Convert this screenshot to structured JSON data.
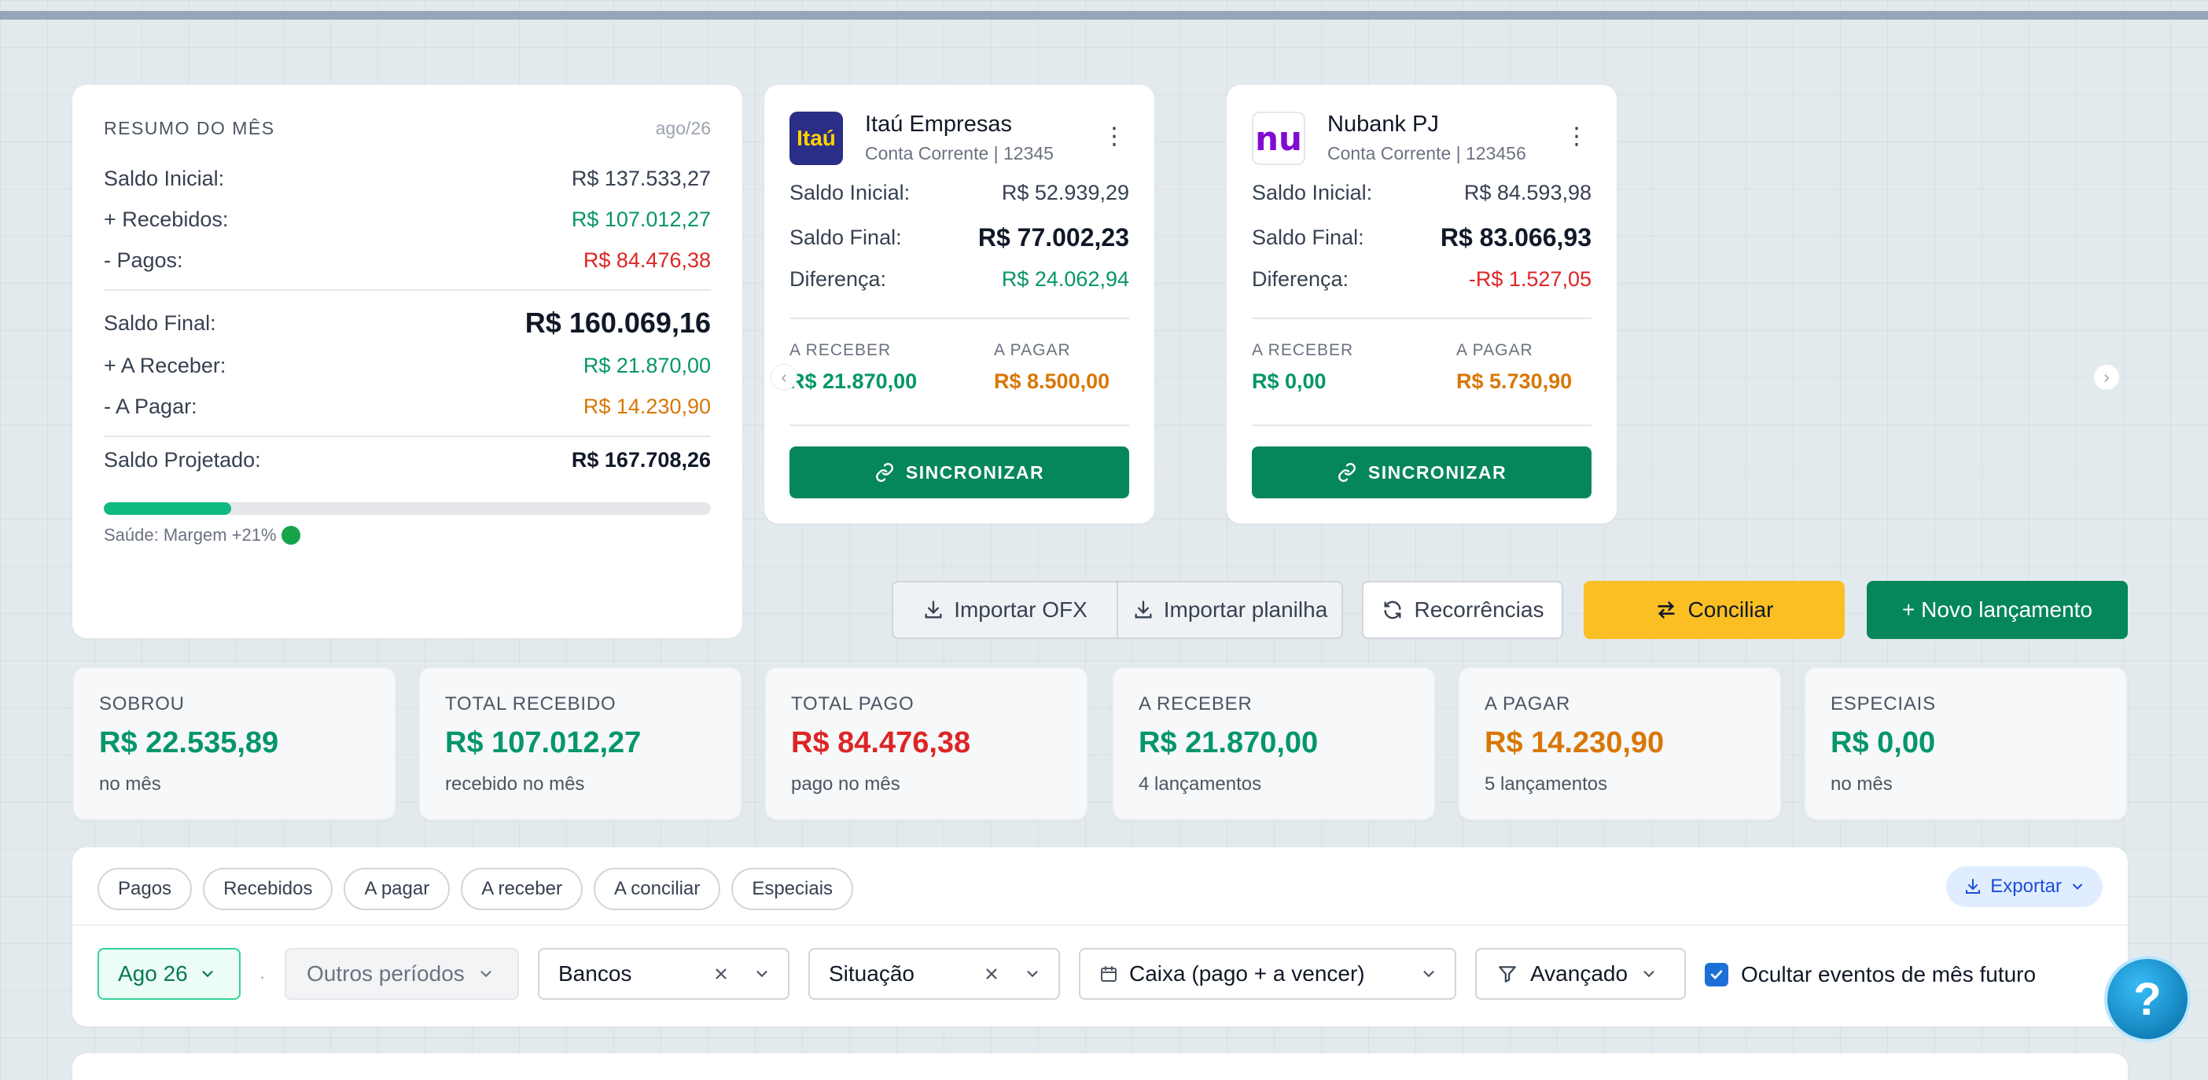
{
  "summary": {
    "title": "RESUMO DO MÊS",
    "period": "ago/26",
    "rows": [
      {
        "label": "Saldo Inicial:",
        "value": "R$ 137.533,27"
      },
      {
        "label": "+ Recebidos:",
        "value": "R$ 107.012,27"
      },
      {
        "label": "- Pagos:",
        "value": "R$ 84.476,38"
      },
      {
        "label": "Saldo Final:",
        "value": "R$ 160.069,16"
      },
      {
        "label": "+ A Receber:",
        "value": "R$ 21.870,00"
      },
      {
        "label": "- A Pagar:",
        "value": "R$ 14.230,90"
      },
      {
        "label": "Saldo Projetado:",
        "value": "R$ 167.708,26"
      }
    ],
    "health_fraction": 0.21,
    "health_text": "Saúde: Margem +21%"
  },
  "banks": [
    {
      "logo_text": "Itaú",
      "name": "Itaú Empresas",
      "account": "Conta Corrente | 12345",
      "initial_label": "Saldo Inicial:",
      "initial": "R$ 52.939,29",
      "final_label": "Saldo Final:",
      "final": "R$ 77.002,23",
      "diff_label": "Diferença:",
      "diff": "R$ 24.062,94",
      "receive_label": "A RECEBER",
      "receive": "R$ 21.870,00",
      "pay_label": "A PAGAR",
      "pay": "R$ 8.500,00",
      "sync": "SINCRONIZAR"
    },
    {
      "logo_text": "nu",
      "name": "Nubank PJ",
      "account": "Conta Corrente | 123456",
      "initial_label": "Saldo Inicial:",
      "initial": "R$ 84.593,98",
      "final_label": "Saldo Final:",
      "final": "R$ 83.066,93",
      "diff_label": "Diferença:",
      "diff": "-R$ 1.527,05",
      "receive_label": "A RECEBER",
      "receive": "R$ 0,00",
      "pay_label": "A PAGAR",
      "pay": "R$ 5.730,90",
      "sync": "SINCRONIZAR"
    }
  ],
  "actions": {
    "import_ofx": "Importar OFX",
    "import_sheet": "Importar planilha",
    "recurrences": "Recorrências",
    "reconcile": "Conciliar",
    "new_entry": "+ Novo lançamento"
  },
  "stats": [
    {
      "label": "SOBROU",
      "value": "R$ 22.535,89",
      "sub": "no mês",
      "color": "#059669"
    },
    {
      "label": "TOTAL RECEBIDO",
      "value": "R$ 107.012,27",
      "sub": "recebido no mês",
      "color": "#059669"
    },
    {
      "label": "TOTAL PAGO",
      "value": "R$ 84.476,38",
      "sub": "pago no mês",
      "color": "#dc2626"
    },
    {
      "label": "A RECEBER",
      "value": "R$ 21.870,00",
      "sub": "4 lançamentos",
      "color": "#059669"
    },
    {
      "label": "A PAGAR",
      "value": "R$ 14.230,90",
      "sub": "5 lançamentos",
      "color": "#d97706"
    },
    {
      "label": "ESPECIAIS",
      "value": "R$ 0,00",
      "sub": "no mês",
      "color": "#059669"
    }
  ],
  "filters": {
    "chips": [
      "Pagos",
      "Recebidos",
      "A pagar",
      "A receber",
      "A conciliar",
      "Especiais"
    ],
    "export": "Exportar",
    "period": "Ago 26",
    "separator": "·",
    "other_periods": "Outros períodos",
    "banks": "Bancos",
    "status": "Situação",
    "cash_mode": "Caixa (pago + a vencer)",
    "advanced": "Avançado",
    "hide_future": "Ocultar eventos de mês futuro"
  },
  "colors": {
    "primary_green": "#06875a",
    "accent_yellow": "#fbbf24",
    "positive": "#059669",
    "negative": "#dc2626",
    "warning": "#d97706"
  }
}
